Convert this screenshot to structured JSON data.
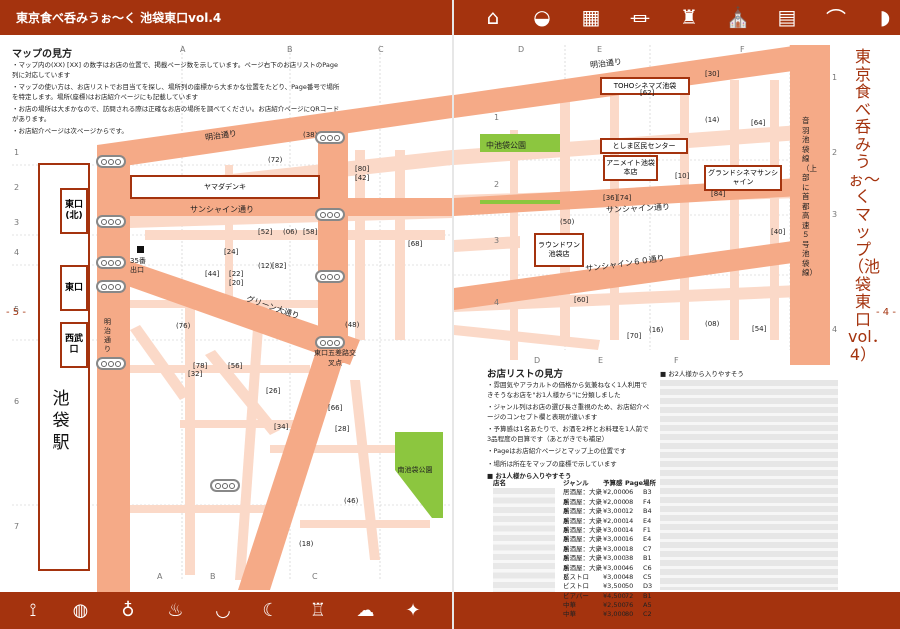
{
  "header": {
    "title": "東京食べ呑みうぉ〜く 池袋東口vol.4",
    "icons_top": [
      "house-icon",
      "sushi-icon",
      "building-icon",
      "museum-icon",
      "tower-icon",
      "church-icon",
      "factory-icon",
      "bridge-icon",
      "shinkansen-icon"
    ],
    "icons_bottom": [
      "cocktail-icon",
      "pizza-icon",
      "beer-icon",
      "ramen-icon",
      "rice-bowl-icon",
      "shrimp-icon",
      "sake-icon",
      "cake-icon",
      "toast-icon"
    ]
  },
  "colors": {
    "brand": "#a4330e",
    "road": "#f5aa87",
    "road_light": "#fbd9c8",
    "park": "#8cc63f"
  },
  "left_page": {
    "instructions_title": "マップの見方",
    "instructions": [
      "・マップ内の(XX) [XX] の数字はお店の位置で、掲載ページ数を示しています。ページ右下のお店リストのPage列に対応しています",
      "・マップの使い方は、お店リストでお目当てを探し、場所列の座標から大まかな位置をたどり、Page番号で場所を特定します。場所(座標)はお店紹介ページにも記載しています",
      "・お店の場所は大まかなので、訪問される際は正確なお店の場所を調べてください。お店紹介ページにQRコードがあります。",
      "・お店紹介ページは次ページからです。"
    ],
    "page_number": "- 5 -",
    "station": "池袋駅",
    "exits": [
      "東口(北)",
      "東口",
      "西武口"
    ],
    "exit35": "35番出口",
    "shop_yamada": "ヤマダデンキ",
    "park": "南池袋公園",
    "intersection": "東口五差路交叉点",
    "streets": {
      "meiji": "明治通り",
      "sunshine": "サンシャイン通り",
      "green": "グリーン大通り",
      "meiji_v": "明治通り"
    },
    "cols": [
      "A",
      "B",
      "C"
    ],
    "rows": [
      "1",
      "2",
      "3",
      "4",
      "5",
      "6",
      "7"
    ],
    "spots": [
      "(38)",
      "(72)",
      "[80]",
      "[42]",
      "[52]",
      "(06)",
      "[58]",
      "[24]",
      "[68]",
      "[44]",
      "[22]",
      "[20]",
      "(12)",
      "[82]",
      "(76)",
      "(48)",
      "[78]",
      "[32]",
      "[56]",
      "[26]",
      "[66]",
      "[34]",
      "[28]",
      "(46)",
      "(18)"
    ]
  },
  "right_page": {
    "page_number": "- 4 -",
    "vertical_title": "東京食べ呑みうぉ〜くマップ（池袋東口vol．4）",
    "cols": [
      "D",
      "E",
      "F"
    ],
    "rows": [
      "1",
      "2",
      "3",
      "4"
    ],
    "shops": {
      "toho": "TOHOシネマズ池袋",
      "toshima": "としま区民センター",
      "animate": "アニメイト池袋本店",
      "grand": "グランドシネマサンシャイン",
      "round1": "ラウンドワン池袋店"
    },
    "park": "中池袋公園",
    "streets": {
      "meiji": "明治通り",
      "sunshine": "サンシャイン通り",
      "sunshine60": "サンシャイン６０通り",
      "otowa": "音羽池袋線（上部に首都高速５号池袋線）"
    },
    "spots": [
      "[30]",
      "[62]",
      "(14)",
      "[64]",
      "[10]",
      "[36]",
      "[74]",
      "[84]",
      "(50)",
      "[40]",
      "[60]",
      "(16)",
      "(08)",
      "[54]",
      "[70]"
    ],
    "list_title": "お店リストの見方",
    "list_notes": [
      "・雰囲気やアラカルトの価格から気兼ねなく1人利用できそうなお店を\"お1人様から\"に分類しました",
      "・ジャンル列はお店の選び長さ重視のため、お店紹介ページのコンセプト欄と表現が違います",
      "・予算感は1名あたりで、お酒を2杯とお料理を1人前で3品程度の目算です（あとがきでも補足）",
      "・Pageはお店紹介ページとマップ上の位置です",
      "・場所は所在をマップの座標で示しています"
    ],
    "solo_title": "■ お1人様から入りやすそう",
    "duo_title": "■ お2人様から入りやすそう",
    "table_header": [
      "店名",
      "ジャンル",
      "予算感",
      "Page",
      "場所"
    ],
    "table_rows": [
      [
        "",
        "居酒屋：大衆系",
        "¥2,000",
        "06",
        "B3"
      ],
      [
        "",
        "居酒屋：大衆系",
        "¥2,000",
        "08",
        "F4"
      ],
      [
        "",
        "居酒屋：大衆系",
        "¥3,000",
        "12",
        "B4"
      ],
      [
        "",
        "居酒屋：大衆系",
        "¥2,000",
        "14",
        "E4"
      ],
      [
        "",
        "居酒屋：大衆系",
        "¥3,000",
        "14",
        "F1"
      ],
      [
        "",
        "居酒屋：大衆系",
        "¥3,000",
        "16",
        "E4"
      ],
      [
        "",
        "居酒屋：大衆系",
        "¥3,000",
        "18",
        "C7"
      ],
      [
        "",
        "居酒屋：大衆系",
        "¥3,000",
        "38",
        "B1"
      ],
      [
        "",
        "居酒屋：大衆系",
        "¥3,000",
        "46",
        "C6"
      ],
      [
        "",
        "ビストロ",
        "¥3,000",
        "48",
        "C5"
      ],
      [
        "",
        "ビストロ",
        "¥3,500",
        "50",
        "D3"
      ],
      [
        "",
        "ビアパー",
        "¥4,500",
        "72",
        "B1"
      ],
      [
        "",
        "中華",
        "¥2,500",
        "76",
        "A5"
      ],
      [
        "",
        "中華",
        "¥3,000",
        "80",
        "C2"
      ]
    ]
  }
}
